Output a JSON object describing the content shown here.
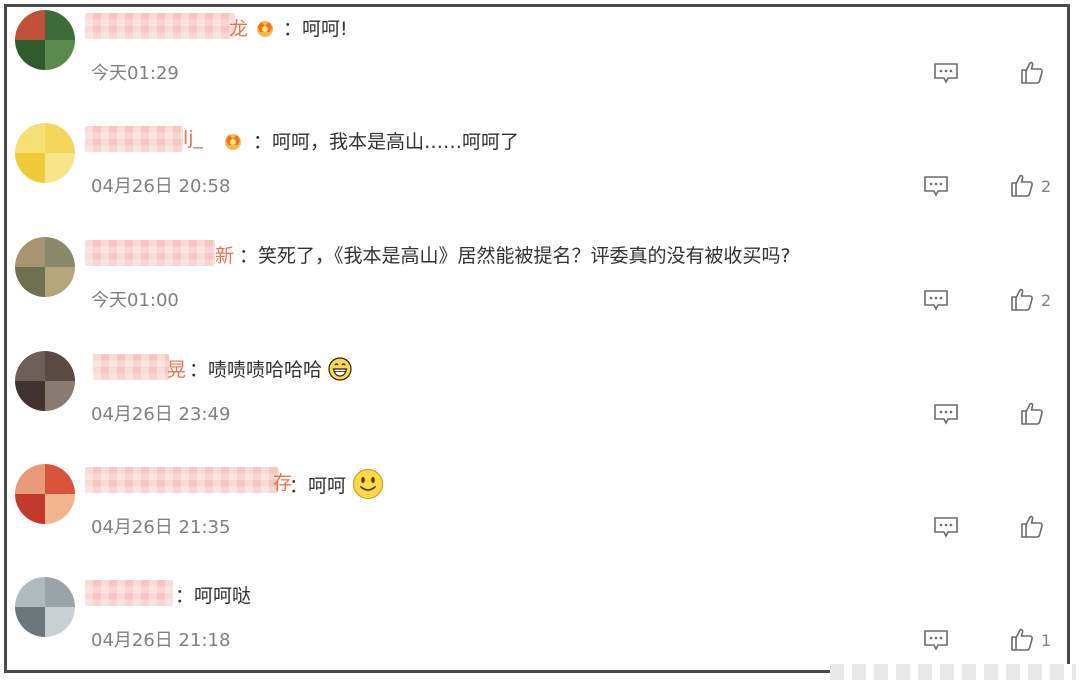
{
  "comments": [
    {
      "name_visible": "龙",
      "colon": "：",
      "text": "呵呵!",
      "time": "今天01:29",
      "likes": "",
      "badge_color": "#f29b1d"
    },
    {
      "name_visible": "lj_",
      "colon": "：",
      "text": "呵呵，我本是高山……呵呵了",
      "time": "04月26日 20:58",
      "likes": "2",
      "badge_color": "#f29b1d"
    },
    {
      "name_visible": "新",
      "colon": "：",
      "text": "笑死了，《我本是高山》居然能被提名？评委真的没有被收买吗?",
      "time": "今天01:00",
      "likes": "2",
      "badge_color": ""
    },
    {
      "name_visible": "晃",
      "colon": "：",
      "text": "啧啧啧哈哈哈",
      "time": "04月26日 23:49",
      "likes": "",
      "emoji": "grinning-face-icon"
    },
    {
      "name_visible": "存",
      "colon": "：",
      "text": "呵呵",
      "time": "04月26日 21:35",
      "likes": "",
      "emoji": "smiling-face-icon"
    },
    {
      "name_visible": "",
      "colon": "：",
      "text": "呵呵哒",
      "time": "04月26日 21:18",
      "likes": "1"
    }
  ],
  "colors": {
    "text": "#333333",
    "meta": "#808080",
    "username": "#eb7350",
    "border": "#4a4a4a"
  }
}
